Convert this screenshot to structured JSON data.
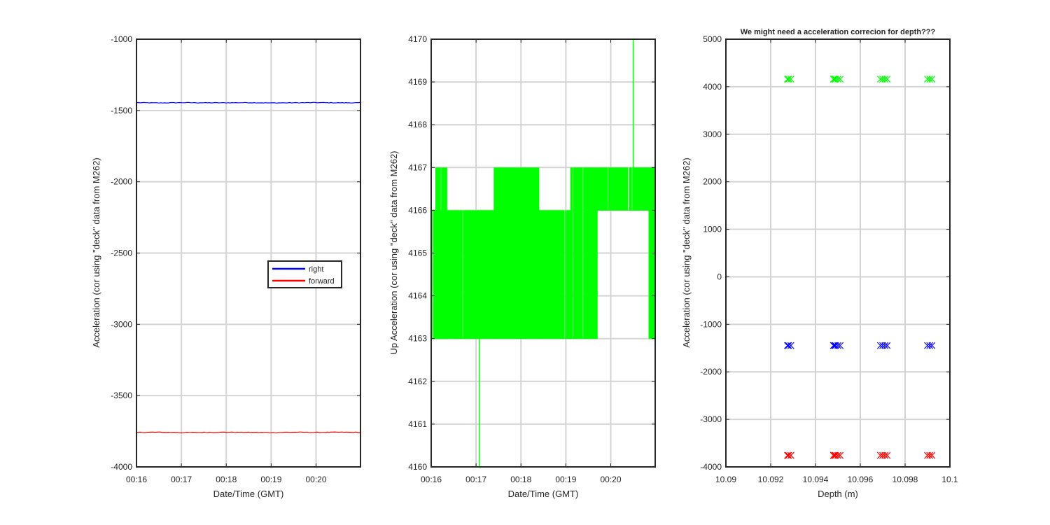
{
  "chart_data": [
    {
      "type": "line",
      "title": "",
      "xlabel": "Date/Time (GMT)",
      "ylabel": "Acceleration (cor using \"deck\" data from M262)",
      "x_tick_labels": [
        "00:16",
        "00:17",
        "00:18",
        "00:19",
        "00:20"
      ],
      "x_ticks_minutes": [
        16,
        17,
        18,
        19,
        20
      ],
      "xlim_minutes": [
        16,
        20.99
      ],
      "ylim": [
        -4000,
        -1000
      ],
      "y_ticks": [
        -4000,
        -3500,
        -3000,
        -2500,
        -2000,
        -1500,
        -1000
      ],
      "grid": true,
      "legend_location": "center-right",
      "series": [
        {
          "name": "right",
          "color": "#0000ff",
          "x_minutes": [
            16,
            16.5,
            17,
            17.5,
            18,
            18.5,
            19,
            19.5,
            20,
            20.5,
            20.99
          ],
          "values": [
            -1445,
            -1447,
            -1445,
            -1446,
            -1446,
            -1445,
            -1447,
            -1446,
            -1445,
            -1446,
            -1446
          ]
        },
        {
          "name": "forward",
          "color": "#ff0000",
          "x_minutes": [
            16,
            16.5,
            17,
            17.5,
            18,
            18.5,
            19,
            19.5,
            20,
            20.5,
            20.99
          ],
          "values": [
            -3758,
            -3757,
            -3759,
            -3758,
            -3757,
            -3758,
            -3759,
            -3757,
            -3758,
            -3757,
            -3758
          ]
        }
      ]
    },
    {
      "type": "line",
      "title": "",
      "xlabel": "Date/Time (GMT)",
      "ylabel": "Up Acceleration (cor using \"deck\" data from M262)",
      "x_tick_labels": [
        "00:16",
        "00:17",
        "00:18",
        "00:19",
        "00:20"
      ],
      "x_ticks_minutes": [
        16,
        17,
        18,
        19,
        20
      ],
      "xlim_minutes": [
        16,
        20.99
      ],
      "ylim": [
        4160,
        4170
      ],
      "y_ticks": [
        4160,
        4161,
        4162,
        4163,
        4164,
        4165,
        4166,
        4167,
        4168,
        4169,
        4170
      ],
      "grid": true,
      "series": [
        {
          "color": "#00ff00",
          "level_segments": [
            {
              "x_start": 16.0,
              "x_end": 16.55,
              "levels": [
                4163,
                4166
              ]
            },
            {
              "x_start": 16.1,
              "x_end": 16.35,
              "levels": [
                4163,
                4167
              ]
            },
            {
              "x_start": 16.55,
              "x_end": 17.1,
              "levels": [
                4163,
                4166
              ]
            },
            {
              "x_start": 17.1,
              "x_end": 17.4,
              "levels": [
                4163,
                4166
              ]
            },
            {
              "x_start": 17.4,
              "x_end": 18.4,
              "levels": [
                4163,
                4167
              ]
            },
            {
              "x_start": 18.4,
              "x_end": 19.1,
              "levels": [
                4163,
                4166
              ]
            },
            {
              "x_start": 19.1,
              "x_end": 19.7,
              "levels": [
                4163,
                4167
              ]
            },
            {
              "x_start": 19.7,
              "x_end": 20.5,
              "levels": [
                4166,
                4167
              ]
            },
            {
              "x_start": 20.5,
              "x_end": 20.99,
              "levels": [
                4166,
                4167
              ]
            },
            {
              "x_start": 20.85,
              "x_end": 20.99,
              "levels": [
                4163,
                4166
              ]
            }
          ],
          "spikes": [
            {
              "x": 17.07,
              "values": [
                4163,
                4160
              ]
            },
            {
              "x": 20.5,
              "values": [
                4166,
                4170
              ]
            }
          ]
        }
      ]
    },
    {
      "type": "scatter",
      "title": "We might need a acceleration correcion for depth???",
      "xlabel": "Depth (m)",
      "ylabel": "Acceleration (cor using \"deck\" data from M262)",
      "x_tick_labels": [
        "10.09",
        "10.092",
        "10.094",
        "10.096",
        "10.098",
        "10.1"
      ],
      "x_ticks": [
        10.09,
        10.092,
        10.094,
        10.096,
        10.098,
        10.1
      ],
      "xlim": [
        10.09,
        10.1
      ],
      "ylim": [
        -4000,
        5000
      ],
      "y_ticks": [
        -4000,
        -3000,
        -2000,
        -1000,
        0,
        1000,
        2000,
        3000,
        4000,
        5000
      ],
      "grid": true,
      "marker": "x",
      "series": [
        {
          "color": "#00ff00",
          "x": [
            10.09275,
            10.0928,
            10.0929,
            10.0948,
            10.09485,
            10.0949,
            10.095,
            10.0951,
            10.0969,
            10.097,
            10.0971,
            10.0972,
            10.099,
            10.0991,
            10.0992
          ],
          "values": [
            4160,
            4160,
            4160,
            4160,
            4160,
            4160,
            4160,
            4160,
            4160,
            4160,
            4160,
            4160,
            4160,
            4160,
            4160
          ]
        },
        {
          "color": "#0000ff",
          "x": [
            10.09275,
            10.0928,
            10.0929,
            10.0948,
            10.09485,
            10.0949,
            10.095,
            10.0951,
            10.0969,
            10.097,
            10.0971,
            10.0972,
            10.099,
            10.0991,
            10.0992
          ],
          "values": [
            -1446,
            -1446,
            -1446,
            -1446,
            -1446,
            -1446,
            -1446,
            -1446,
            -1446,
            -1446,
            -1446,
            -1446,
            -1446,
            -1446,
            -1446
          ]
        },
        {
          "color": "#ff0000",
          "x": [
            10.09275,
            10.0928,
            10.0929,
            10.0948,
            10.09485,
            10.0949,
            10.095,
            10.0951,
            10.0969,
            10.097,
            10.0971,
            10.0972,
            10.099,
            10.0991,
            10.0992
          ],
          "values": [
            -3758,
            -3758,
            -3758,
            -3758,
            -3758,
            -3758,
            -3758,
            -3758,
            -3758,
            -3758,
            -3758,
            -3758,
            -3758,
            -3758,
            -3758
          ]
        }
      ]
    }
  ]
}
